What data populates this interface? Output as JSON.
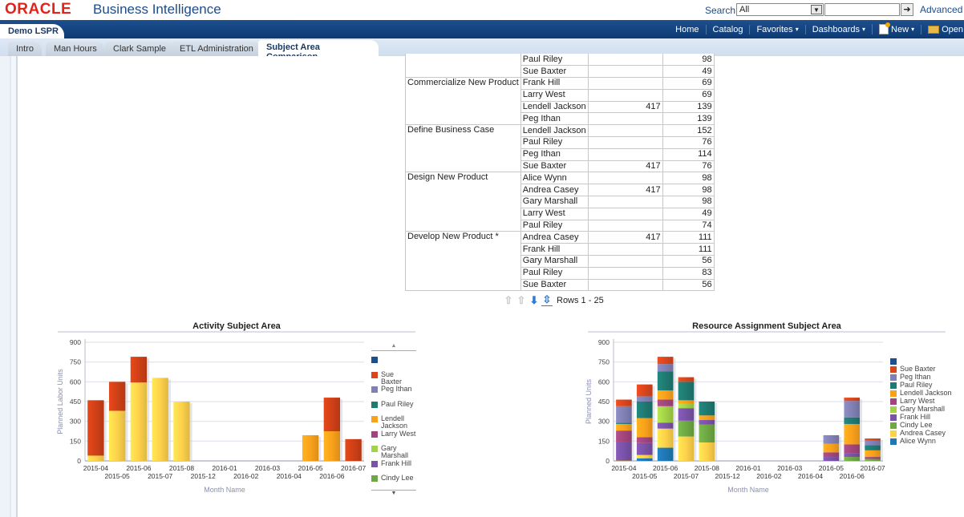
{
  "header": {
    "brand": "ORACLE",
    "product": "Business Intelligence",
    "search_label": "Search",
    "search_scope": "All",
    "search_query": "",
    "advanced_label": "Advanced"
  },
  "nav": {
    "dashboard_title": "Demo LSPR",
    "links": [
      {
        "label": "Home"
      },
      {
        "label": "Catalog"
      },
      {
        "label": "Favorites",
        "caret": "▾"
      },
      {
        "label": "Dashboards",
        "caret": "▾"
      },
      {
        "label": "New",
        "caret": "▾"
      },
      {
        "label": "Open"
      }
    ]
  },
  "tabs": [
    {
      "label": "Intro"
    },
    {
      "label": "Man Hours"
    },
    {
      "label": "Clark Sample"
    },
    {
      "label": "ETL Administration"
    },
    {
      "label": "Subject Area Comparison",
      "active": true
    }
  ],
  "pivot": {
    "groups": [
      {
        "activity": "",
        "rows": [
          {
            "resource": "Paul Riley",
            "c1": "",
            "c2": "98"
          },
          {
            "resource": "Sue Baxter",
            "c1": "",
            "c2": "49"
          }
        ]
      },
      {
        "activity": "Commercialize New Product",
        "rows": [
          {
            "resource": "Frank Hill",
            "c1": "",
            "c2": "69"
          },
          {
            "resource": "Larry West",
            "c1": "",
            "c2": "69"
          },
          {
            "resource": "Lendell Jackson",
            "c1": "417",
            "c2": "139"
          },
          {
            "resource": "Peg Ithan",
            "c1": "",
            "c2": "139"
          }
        ]
      },
      {
        "activity": "Define Business Case",
        "rows": [
          {
            "resource": "Lendell Jackson",
            "c1": "",
            "c2": "152"
          },
          {
            "resource": "Paul Riley",
            "c1": "",
            "c2": "76"
          },
          {
            "resource": "Peg Ithan",
            "c1": "",
            "c2": "114"
          },
          {
            "resource": "Sue Baxter",
            "c1": "417",
            "c2": "76"
          }
        ]
      },
      {
        "activity": "Design New Product",
        "rows": [
          {
            "resource": "Alice Wynn",
            "c1": "",
            "c2": "98"
          },
          {
            "resource": "Andrea Casey",
            "c1": "417",
            "c2": "98"
          },
          {
            "resource": "Gary Marshall",
            "c1": "",
            "c2": "98"
          },
          {
            "resource": "Larry West",
            "c1": "",
            "c2": "49"
          },
          {
            "resource": "Paul Riley",
            "c1": "",
            "c2": "74"
          }
        ]
      },
      {
        "activity": "Develop New Product *",
        "rows": [
          {
            "resource": "Andrea Casey",
            "c1": "417",
            "c2": "111"
          },
          {
            "resource": "Frank Hill",
            "c1": "",
            "c2": "111"
          },
          {
            "resource": "Gary Marshall",
            "c1": "",
            "c2": "56"
          },
          {
            "resource": "Paul Riley",
            "c1": "",
            "c2": "83"
          },
          {
            "resource": "Sue Baxter",
            "c1": "",
            "c2": "56"
          }
        ]
      }
    ],
    "pager": {
      "rows_label": "Rows 1 - 25",
      "icons": [
        "first-page-icon",
        "prev-page-icon",
        "next-page-icon",
        "all-rows-icon"
      ]
    }
  },
  "colors": {
    "unnamed": "#1f4e8c",
    "Sue Baxter": "#d9461b",
    "Peg Ithan": "#8080b4",
    "Paul Riley": "#1f7a72",
    "Lendell Jackson": "#f9a11b",
    "Larry West": "#a2457d",
    "Gary Marshall": "#a3d147",
    "Frank Hill": "#7a52a8",
    "Cindy Lee": "#6ea844",
    "Andrea Casey": "#fdd14a",
    "Alice Wynn": "#1f78b4",
    "Sue Baxter Left": "#cf4017"
  },
  "chart_data": [
    {
      "type": "bar",
      "stacked": true,
      "title": "Activity Subject Area",
      "xlabel": "Month Name",
      "ylabel": "Planned Labor Units",
      "ylim": [
        0,
        900
      ],
      "yticks": [
        0,
        150,
        300,
        450,
        600,
        750,
        900
      ],
      "grid": true,
      "legend_position": "right",
      "legend_scrollable": true,
      "categories": [
        "2015-04",
        "2015-05",
        "2015-06",
        "2015-07",
        "2015-08",
        "2015-12",
        "2016-01",
        "2016-02",
        "2016-03",
        "2016-04",
        "2016-05",
        "2016-06",
        "2016-07"
      ],
      "legend": [
        "",
        "Sue Baxter",
        "Peg Ithan",
        "Paul Riley",
        "Lendell Jackson",
        "Larry West",
        "Gary Marshall",
        "Frank Hill",
        "Cindy Lee"
      ],
      "series": [
        {
          "name": "Andrea Casey",
          "values": [
            40,
            380,
            595,
            630,
            450,
            0,
            0,
            0,
            0,
            0,
            0,
            0,
            0
          ]
        },
        {
          "name": "Lendell Jackson",
          "values": [
            0,
            0,
            0,
            0,
            0,
            0,
            0,
            0,
            0,
            0,
            195,
            225,
            0
          ]
        },
        {
          "name": "Sue Baxter",
          "values": [
            420,
            220,
            195,
            0,
            0,
            0,
            0,
            0,
            0,
            0,
            0,
            255,
            165
          ]
        }
      ]
    },
    {
      "type": "bar",
      "stacked": true,
      "title": "Resource Assignment Subject Area",
      "xlabel": "Month Name",
      "ylabel": "Planned Units",
      "ylim": [
        0,
        900
      ],
      "yticks": [
        0,
        150,
        300,
        450,
        600,
        750,
        900
      ],
      "grid": true,
      "legend_position": "right",
      "categories": [
        "2015-04",
        "2015-05",
        "2015-06",
        "2015-07",
        "2015-08",
        "2015-12",
        "2016-01",
        "2016-02",
        "2016-03",
        "2016-04",
        "2016-05",
        "2016-06",
        "2016-07"
      ],
      "legend": [
        "",
        "Sue Baxter",
        "Peg Ithan",
        "Paul Riley",
        "Lendell Jackson",
        "Larry West",
        "Gary Marshall",
        "Frank Hill",
        "Cindy Lee",
        "Andrea Casey",
        "Alice Wynn"
      ],
      "series": [
        {
          "name": "",
          "values": [
            5,
            0,
            0,
            0,
            0,
            0,
            0,
            0,
            0,
            0,
            0,
            0,
            0
          ]
        },
        {
          "name": "Alice Wynn",
          "values": [
            0,
            20,
            100,
            0,
            0,
            0,
            0,
            0,
            0,
            0,
            0,
            0,
            0
          ]
        },
        {
          "name": "Andrea Casey",
          "values": [
            0,
            25,
            145,
            185,
            140,
            0,
            0,
            0,
            0,
            0,
            0,
            0,
            0
          ]
        },
        {
          "name": "Cindy Lee",
          "values": [
            0,
            0,
            0,
            120,
            135,
            0,
            0,
            0,
            0,
            0,
            0,
            30,
            15
          ]
        },
        {
          "name": "Frank Hill",
          "values": [
            135,
            90,
            45,
            95,
            35,
            0,
            0,
            0,
            0,
            0,
            30,
            30,
            0
          ]
        },
        {
          "name": "Gary Marshall",
          "values": [
            0,
            0,
            125,
            35,
            0,
            0,
            0,
            0,
            0,
            0,
            0,
            0,
            0
          ]
        },
        {
          "name": "Larry West",
          "values": [
            90,
            45,
            50,
            0,
            0,
            0,
            0,
            0,
            0,
            0,
            35,
            65,
            15
          ]
        },
        {
          "name": "Lendell Jackson",
          "values": [
            50,
            145,
            70,
            25,
            35,
            0,
            0,
            0,
            0,
            0,
            65,
            155,
            50
          ]
        },
        {
          "name": "Paul Riley",
          "values": [
            10,
            125,
            145,
            140,
            105,
            0,
            0,
            0,
            0,
            0,
            0,
            50,
            40
          ]
        },
        {
          "name": "Peg Ithan",
          "values": [
            125,
            40,
            55,
            0,
            0,
            0,
            0,
            0,
            0,
            0,
            65,
            125,
            35
          ]
        },
        {
          "name": "Sue Baxter",
          "values": [
            50,
            90,
            55,
            35,
            0,
            0,
            0,
            0,
            0,
            0,
            0,
            25,
            15
          ]
        }
      ]
    }
  ]
}
